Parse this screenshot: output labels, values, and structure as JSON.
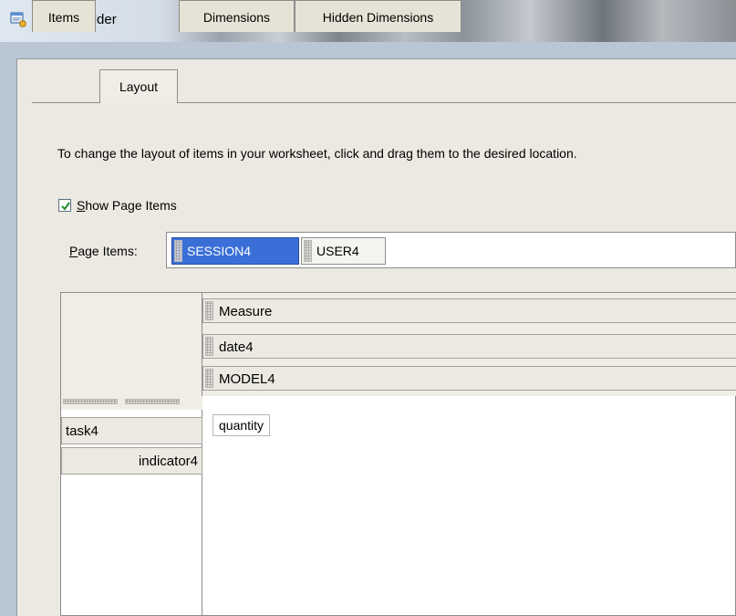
{
  "window": {
    "title": "Query Builder"
  },
  "tabs": [
    {
      "label": "Items",
      "active": false
    },
    {
      "label": "Layout",
      "active": true
    },
    {
      "label": "Dimensions",
      "active": false
    },
    {
      "label": "Hidden Dimensions",
      "active": false
    }
  ],
  "layout": {
    "instructions": "To change the layout of items in your worksheet, click and drag them to the desired location.",
    "show_page_items": {
      "checked": true,
      "label_prefix": "S",
      "label_rest": "how Page Items"
    },
    "page_items": {
      "label_prefix": "P",
      "label_rest": "age Items:",
      "items": [
        {
          "label": "SESSION4",
          "selected": true
        },
        {
          "label": "USER4",
          "selected": false
        }
      ]
    },
    "top_axis": [
      "Measure",
      "date4",
      "MODEL4"
    ],
    "side_axis": [
      "task4",
      "indicator4"
    ],
    "data_cell": "quantity"
  },
  "colors": {
    "selected_chip": "#3a6fd8",
    "panel": "#ebe9e1",
    "frame": "#b9c6d3"
  }
}
